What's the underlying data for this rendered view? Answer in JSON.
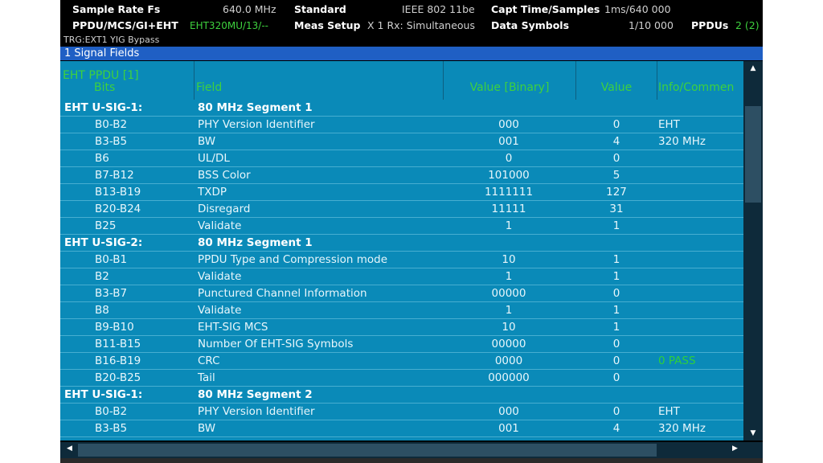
{
  "header": {
    "sample_rate_label": "Sample Rate Fs",
    "sample_rate_value": "640.0 MHz",
    "standard_label": "Standard",
    "standard_value": "IEEE 802 11be",
    "capt_label": "Capt Time/Samples",
    "capt_value": "1ms/640 000",
    "ppdu_label": "PPDU/MCS/GI+EHT",
    "ppdu_value": "EHT320MU/13/--",
    "meas_label": "Meas Setup",
    "meas_value": "X 1 Rx: Simultaneous",
    "data_symbols_label": "Data Symbols",
    "data_symbols_value": "1/10 000",
    "ppdus_label": "PPDUs",
    "ppdus_value": "2 (2)",
    "trigger": "TRG:EXT1 YIG Bypass"
  },
  "window_title": "1 Signal Fields",
  "columns": {
    "group": "EHT  PPDU [1]",
    "bits": "Bits",
    "field": "Field",
    "binary": "Value [Binary]",
    "value": "Value",
    "info": "Info/Commen"
  },
  "rows": [
    {
      "type": "group",
      "bits": "EHT U-SIG-1:",
      "field": "80 MHz Segment 1",
      "binary": "",
      "value": "",
      "info": ""
    },
    {
      "type": "data",
      "bits": "B0-B2",
      "field": "PHY Version Identifier",
      "binary": "000",
      "value": "0",
      "info": "EHT"
    },
    {
      "type": "data",
      "bits": "B3-B5",
      "field": "BW",
      "binary": "001",
      "value": "4",
      "info": "320 MHz"
    },
    {
      "type": "data",
      "bits": "B6",
      "field": "UL/DL",
      "binary": "0",
      "value": "0",
      "info": ""
    },
    {
      "type": "data",
      "bits": "B7-B12",
      "field": "BSS Color",
      "binary": "101000",
      "value": "5",
      "info": ""
    },
    {
      "type": "data",
      "bits": "B13-B19",
      "field": "TXDP",
      "binary": "1111111",
      "value": "127",
      "info": ""
    },
    {
      "type": "data",
      "bits": "B20-B24",
      "field": "Disregard",
      "binary": "11111",
      "value": "31",
      "info": ""
    },
    {
      "type": "data",
      "bits": "B25",
      "field": "Validate",
      "binary": "1",
      "value": "1",
      "info": ""
    },
    {
      "type": "group",
      "bits": "EHT U-SIG-2:",
      "field": "80 MHz Segment 1",
      "binary": "",
      "value": "",
      "info": ""
    },
    {
      "type": "data",
      "bits": "B0-B1",
      "field": "PPDU Type and Compression mode",
      "binary": "10",
      "value": "1",
      "info": ""
    },
    {
      "type": "data",
      "bits": "B2",
      "field": "Validate",
      "binary": "1",
      "value": "1",
      "info": ""
    },
    {
      "type": "data",
      "bits": "B3-B7",
      "field": "Punctured Channel Information",
      "binary": "00000",
      "value": "0",
      "info": ""
    },
    {
      "type": "data",
      "bits": "B8",
      "field": "Validate",
      "binary": "1",
      "value": "1",
      "info": ""
    },
    {
      "type": "data",
      "bits": "B9-B10",
      "field": "EHT-SIG MCS",
      "binary": "10",
      "value": "1",
      "info": ""
    },
    {
      "type": "data",
      "bits": "B11-B15",
      "field": "Number Of EHT-SIG Symbols",
      "binary": "00000",
      "value": "0",
      "info": ""
    },
    {
      "type": "data",
      "bits": "B16-B19",
      "field": "CRC",
      "binary": "0000",
      "value": "0",
      "info": "0 PASS",
      "info_status": "pass"
    },
    {
      "type": "data",
      "bits": "B20-B25",
      "field": "Tail",
      "binary": "000000",
      "value": "0",
      "info": ""
    },
    {
      "type": "group",
      "bits": "EHT U-SIG-1:",
      "field": "80 MHz Segment 2",
      "binary": "",
      "value": "",
      "info": ""
    },
    {
      "type": "data",
      "bits": "B0-B2",
      "field": "PHY Version Identifier",
      "binary": "000",
      "value": "0",
      "info": "EHT"
    },
    {
      "type": "data",
      "bits": "B3-B5",
      "field": "BW",
      "binary": "001",
      "value": "4",
      "info": "320 MHz"
    }
  ],
  "icons": {
    "scroll_up": "up-arrow-icon",
    "scroll_down": "down-arrow-icon",
    "scroll_left": "left-arrow-icon",
    "scroll_right": "right-arrow-icon"
  },
  "colors": {
    "background": "#000000",
    "table": "#0a8ab8",
    "title_bar": "#1f5fc4",
    "accent_green": "#3ed13e"
  }
}
